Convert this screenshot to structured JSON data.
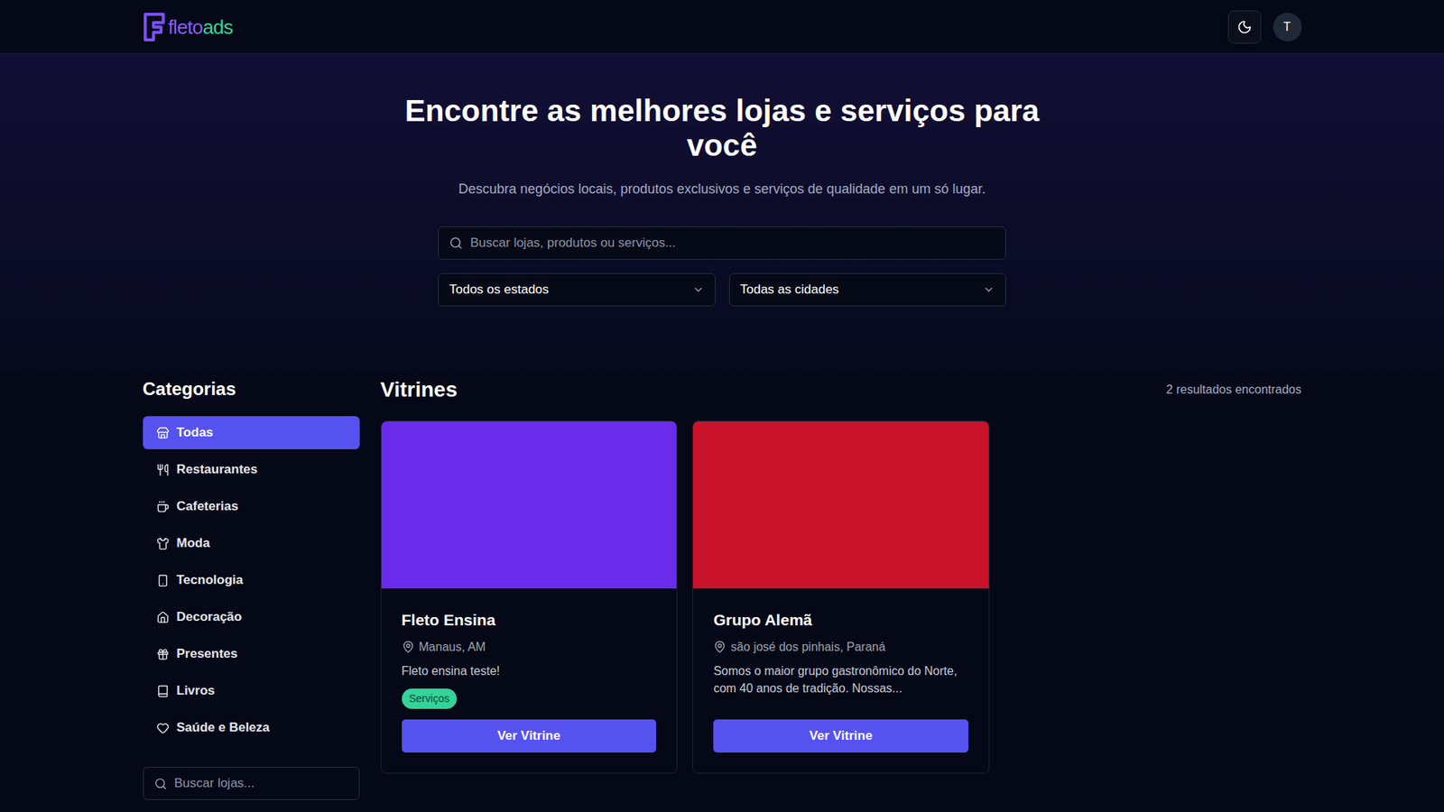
{
  "header": {
    "logo": {
      "part1": "fleto",
      "part2": "ads"
    },
    "avatar": "T"
  },
  "hero": {
    "title": "Encontre as melhores lojas e serviços para você",
    "subtitle": "Descubra negócios locais, produtos exclusivos e serviços de qualidade em um só lugar.",
    "search": {
      "placeholder": "Buscar lojas, produtos ou serviços..."
    },
    "filters": [
      {
        "label": "Todos os estados"
      },
      {
        "label": "Todas as cidades"
      }
    ]
  },
  "sidebar": {
    "title": "Categorias",
    "items": [
      {
        "label": "Todas",
        "selected": true
      },
      {
        "label": "Restaurantes",
        "selected": false
      },
      {
        "label": "Cafeterias",
        "selected": false
      },
      {
        "label": "Moda",
        "selected": false
      },
      {
        "label": "Tecnologia",
        "selected": false
      },
      {
        "label": "Decoração",
        "selected": false
      },
      {
        "label": "Presentes",
        "selected": false
      },
      {
        "label": "Livros",
        "selected": false
      },
      {
        "label": "Saúde e Beleza",
        "selected": false
      }
    ],
    "search": {
      "placeholder": "Buscar lojas..."
    }
  },
  "vitrines": {
    "title": "Vitrines",
    "count": "2 resultados encontrados",
    "cards": [
      {
        "name": "Fleto Ensina",
        "location": "Manaus, AM",
        "description": "Fleto ensina teste!",
        "tags": [
          "Serviços"
        ],
        "button": "Ver Vitrine",
        "color": "#6a2bea"
      },
      {
        "name": "Grupo Alemã",
        "location": "são josé dos pinhais, Paraná",
        "description": "Somos o maior grupo gastronômico do Norte, com 40 anos de tradição. Nossas...",
        "tags": [],
        "button": "Ver Vitrine",
        "color": "#c8132b"
      }
    ]
  }
}
